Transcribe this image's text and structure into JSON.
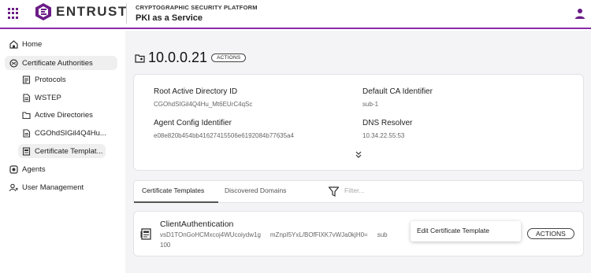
{
  "header": {
    "brand": "ENTRUST",
    "platform": "CRYPTOGRAPHIC SECURITY PLATFORM",
    "product": "PKI as a Service",
    "brand_color": "#6b1d86"
  },
  "sidebar": {
    "items": [
      {
        "label": "Home",
        "icon": "home-icon"
      },
      {
        "label": "Certificate Authorities",
        "icon": "ca-icon"
      },
      {
        "label": "Protocols",
        "icon": "protocols-icon"
      },
      {
        "label": "WSTEP",
        "icon": "document-icon"
      },
      {
        "label": "Active Directories",
        "icon": "folder-icon"
      },
      {
        "label": "CGOhdSIGil4Q4Hu...",
        "icon": "document-icon"
      },
      {
        "label": "Certificate Templat...",
        "icon": "template-icon"
      },
      {
        "label": "Agents",
        "icon": "agents-icon"
      },
      {
        "label": "User Management",
        "icon": "user-management-icon"
      }
    ]
  },
  "main": {
    "title": "10.0.0.21",
    "actions_label": "ACTIONS",
    "details": {
      "root_ad_label": "Root Active Directory ID",
      "root_ad_value": "CGOhdSIGil4Q4Hu_Mt6EUrC4qSc",
      "default_ca_label": "Default CA Identifier",
      "default_ca_value": "sub-1",
      "agent_config_label": "Agent Config Identifier",
      "agent_config_value": "e08e820b454bb41627415506e6192084b77635a4",
      "dns_label": "DNS Resolver",
      "dns_value": "10.34.22.55:53"
    },
    "tabs": [
      {
        "label": "Certificate Templates"
      },
      {
        "label": "Discovered Domains"
      }
    ],
    "filter_placeholder": "Filter...",
    "row": {
      "title": "ClientAuthentication",
      "meta1": "vsD1TOnGoHCMxcoj4WUcoiydw1g",
      "meta2": "mZnpI5YxL/BOfFlXK7vWJa0kjH0=",
      "meta3": "sub",
      "extra": "100",
      "actions_label": "ACTIONS"
    },
    "menu": {
      "item": "Edit Certificate Template"
    }
  }
}
